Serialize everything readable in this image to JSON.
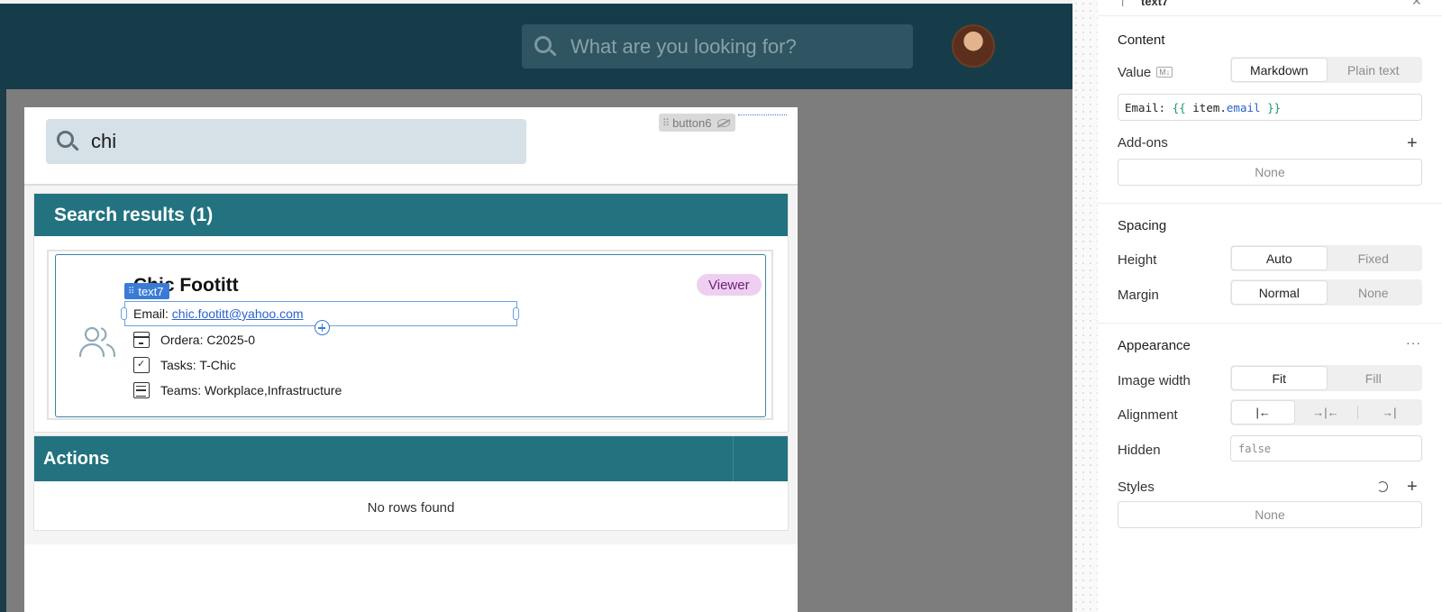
{
  "header": {
    "search_placeholder": "What are you looking for?"
  },
  "page": {
    "search_value": "chi",
    "hidden_component_tag": "button6",
    "results": {
      "title": "Search results (1)",
      "card": {
        "name": "Chic Footitt",
        "role": "Viewer",
        "selected_component_tag": "text7",
        "email_label": "Email: ",
        "email": "chic.footitt@yahoo.com",
        "orders": "Ordera: C2025-0",
        "tasks": "Tasks: T-Chic",
        "teams": "Teams: Workplace,Infrastructure"
      }
    },
    "actions": {
      "title": "Actions",
      "empty_text": "No rows found"
    }
  },
  "panel": {
    "content": {
      "title": "Content",
      "value_label": "Value",
      "value_mode_options": [
        "Markdown",
        "Plain text"
      ],
      "value_mode_selected": "Markdown",
      "value_code": {
        "prefix": "Email: ",
        "open": "{{",
        "obj": " item.",
        "prop": "email",
        "close": " }}"
      },
      "addons_label": "Add-ons",
      "addons_value": "None"
    },
    "spacing": {
      "title": "Spacing",
      "height_label": "Height",
      "height_options": [
        "Auto",
        "Fixed"
      ],
      "height_selected": "Auto",
      "margin_label": "Margin",
      "margin_options": [
        "Normal",
        "None"
      ],
      "margin_selected": "Normal"
    },
    "appearance": {
      "title": "Appearance",
      "more_glyph": "···",
      "image_width_label": "Image width",
      "image_width_options": [
        "Fit",
        "Fill"
      ],
      "image_width_selected": "Fit",
      "alignment_label": "Alignment",
      "alignment_glyphs": [
        "|←",
        "→|←",
        "→|"
      ],
      "hidden_label": "Hidden",
      "hidden_value": "false",
      "styles_label": "Styles",
      "styles_value": "None"
    }
  }
}
